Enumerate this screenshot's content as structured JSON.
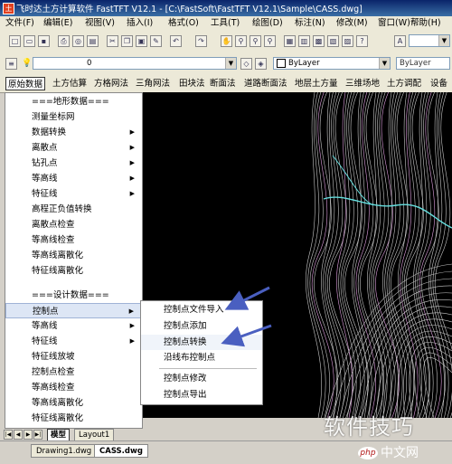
{
  "window": {
    "title": "飞时达土方计算软件 FastTFT V12.1 - [C:\\FastSoft\\FastTFT V12.1\\Sample\\CASS.dwg]"
  },
  "menubar": {
    "items": [
      "文件(F)",
      "编辑(E)",
      "视图(V)",
      "插入(I)",
      "格式(O)",
      "工具(T)",
      "绘图(D)",
      "标注(N)",
      "修改(M)",
      "窗口(W)",
      "帮助(H)"
    ]
  },
  "toolbar2": {
    "layer_value": "0",
    "bylayer_color": "ByLayer",
    "bylayer_linetype": "ByLayer"
  },
  "ribbon_tabs": [
    "原始数据",
    "土方估算",
    "方格网法",
    "三角网法",
    "田块法",
    "断面法",
    "道路断面法",
    "地层土方量",
    "三维场地",
    "土方调配",
    "设备"
  ],
  "left_menu": {
    "items": [
      {
        "label": "===地形数据===",
        "submenu": false
      },
      {
        "label": "测量坐标网",
        "submenu": false
      },
      {
        "label": "数据转换",
        "submenu": true
      },
      {
        "label": "离散点",
        "submenu": true
      },
      {
        "label": "钻孔点",
        "submenu": true
      },
      {
        "label": "等高线",
        "submenu": true
      },
      {
        "label": "特征线",
        "submenu": true
      },
      {
        "label": "高程正负值转换",
        "submenu": false
      },
      {
        "label": "离散点检查",
        "submenu": false
      },
      {
        "label": "等高线检查",
        "submenu": false
      },
      {
        "label": "等高线离散化",
        "submenu": false
      },
      {
        "label": "特征线离散化",
        "submenu": false
      },
      {
        "label": "===设计数据===",
        "submenu": false
      },
      {
        "label": "控制点",
        "submenu": true
      },
      {
        "label": "等高线",
        "submenu": true
      },
      {
        "label": "特征线",
        "submenu": true
      },
      {
        "label": "特征线放坡",
        "submenu": false
      },
      {
        "label": "控制点检查",
        "submenu": false
      },
      {
        "label": "等高线检查",
        "submenu": false
      },
      {
        "label": "等高线离散化",
        "submenu": false
      },
      {
        "label": "特征线离散化",
        "submenu": false
      }
    ]
  },
  "submenu": {
    "items": [
      "控制点文件导入",
      "控制点添加",
      "控制点转换",
      "沿线布控制点",
      "控制点修改",
      "控制点导出"
    ]
  },
  "layout_tabs": [
    "模型",
    "Layout1"
  ],
  "file_tabs": [
    "Drawing1.dwg",
    "CASS.dwg"
  ],
  "watermark": {
    "line1": "软件技巧",
    "php": "php",
    "line2": "中文网"
  },
  "colors": {
    "canvas": "#000000",
    "contour": "#c8c8c8",
    "contour_alt": "#e0a0e0",
    "road": "#66e0e0",
    "highlight_arrow": "#4a5fc0"
  }
}
